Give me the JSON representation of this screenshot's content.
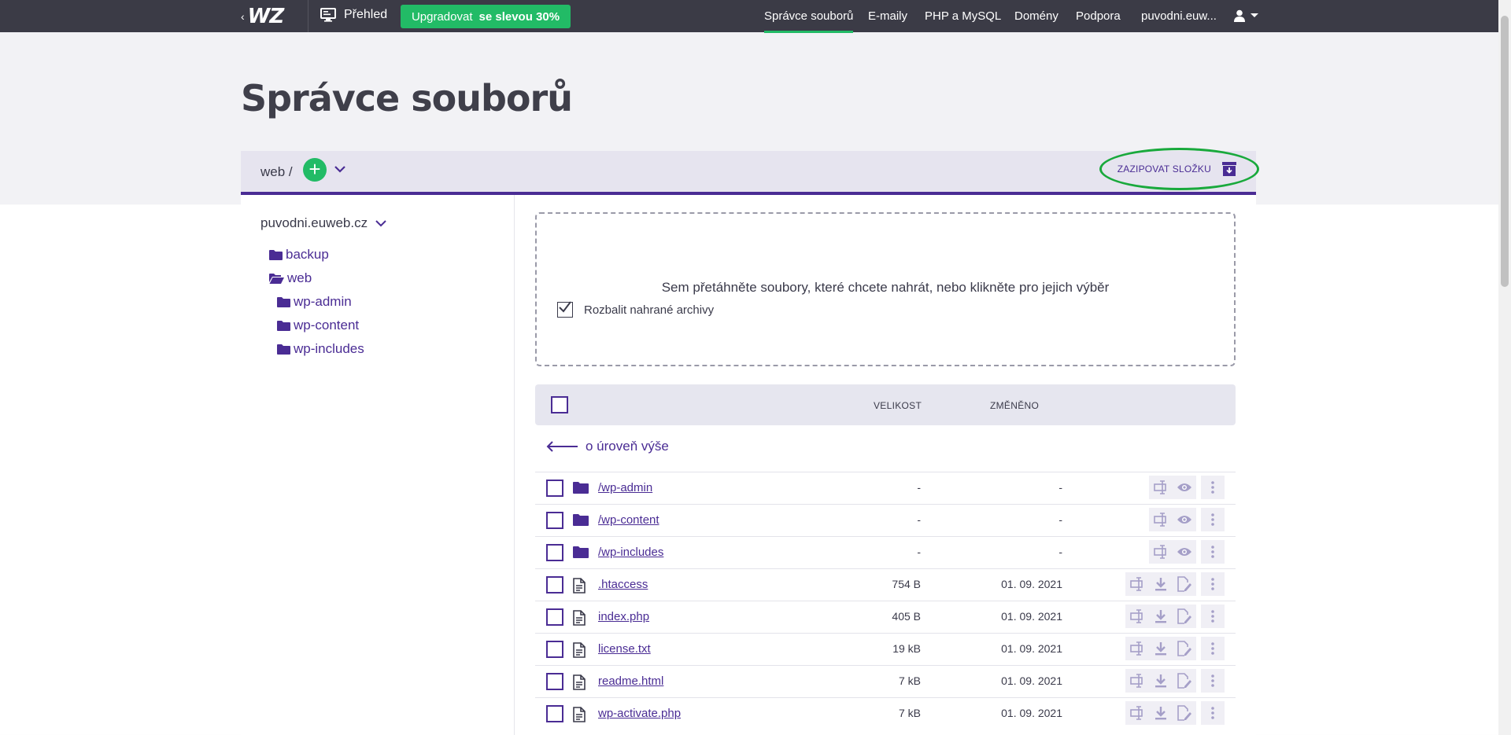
{
  "topbar": {
    "logo": "WZ",
    "overview": "Přehled",
    "upgrade": {
      "label": "Upgradovat",
      "discount": "se slevou 30%"
    },
    "nav": [
      {
        "label": "Správce souborů",
        "active": true
      },
      {
        "label": "E-maily"
      },
      {
        "label": "PHP a MySQL"
      },
      {
        "label": "Domény"
      },
      {
        "label": "Podpora"
      },
      {
        "label": "puvodni.euw..."
      }
    ],
    "user_icon": "user-icon"
  },
  "page": {
    "title": "Správce souborů"
  },
  "pathbar": {
    "path": "web /",
    "add_label": "+",
    "zip_label": "ZAZIPOVAT SLOŽKU",
    "highlight_color": "#19a93c"
  },
  "sidebar": {
    "domain": "puvodni.euweb.cz",
    "tree": [
      {
        "label": "backup",
        "icon": "folder-icon"
      },
      {
        "label": "web",
        "icon": "folder-open-icon"
      },
      {
        "label": "wp-admin",
        "icon": "folder-icon"
      },
      {
        "label": "wp-content",
        "icon": "folder-icon"
      },
      {
        "label": "wp-includes",
        "icon": "folder-icon"
      }
    ]
  },
  "dropzone": {
    "text": "Sem přetáhněte soubory, které chcete nahrát, nebo klikněte pro jejich výběr",
    "checkbox_label": "Rozbalit nahrané archivy",
    "checked": true
  },
  "table": {
    "headers": {
      "size": "VELIKOST",
      "modified": "ZMĚNĚNO"
    },
    "up_level": "o úroveň výše",
    "rows": [
      {
        "type": "folder",
        "name": "/wp-admin",
        "size": "-",
        "modified": "-"
      },
      {
        "type": "folder",
        "name": "/wp-content",
        "size": "-",
        "modified": "-"
      },
      {
        "type": "folder",
        "name": "/wp-includes",
        "size": "-",
        "modified": "-"
      },
      {
        "type": "file",
        "name": ".htaccess",
        "size": "754 B",
        "modified": "01. 09. 2021"
      },
      {
        "type": "file",
        "name": "index.php",
        "size": "405 B",
        "modified": "01. 09. 2021"
      },
      {
        "type": "file",
        "name": "license.txt",
        "size": "19 kB",
        "modified": "01. 09. 2021"
      },
      {
        "type": "file",
        "name": "readme.html",
        "size": "7 kB",
        "modified": "01. 09. 2021"
      },
      {
        "type": "file",
        "name": "wp-activate.php",
        "size": "7 kB",
        "modified": "01. 09. 2021"
      }
    ]
  },
  "colors": {
    "accent": "#4a2c94",
    "green": "#22bb66",
    "topbar": "#3b3b46"
  }
}
